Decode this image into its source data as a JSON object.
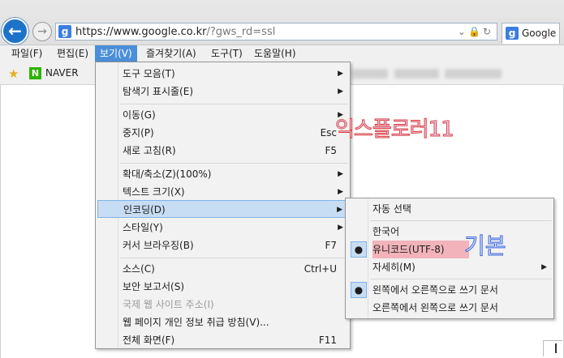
{
  "address_bar": {
    "url_main": "https://www.google.co.kr",
    "url_rest": "/?gws_rd=ssl"
  },
  "tab": {
    "title": "Google"
  },
  "menubar": [
    "파일(F)",
    "편집(E)",
    "보기(V)",
    "즐겨찾기(A)",
    "도구(T)",
    "도움말(H)"
  ],
  "favorites": {
    "naver_label": "NAVER"
  },
  "view_menu": {
    "items": [
      {
        "label": "도구 모음(T)",
        "shortcut": "",
        "submenu": true
      },
      {
        "label": "탐색기 표시줄(E)",
        "shortcut": "",
        "submenu": true
      },
      {
        "label": "이동(G)",
        "shortcut": "",
        "submenu": true
      },
      {
        "label": "중지(P)",
        "shortcut": "Esc",
        "submenu": false
      },
      {
        "label": "새로 고침(R)",
        "shortcut": "F5",
        "submenu": false
      },
      {
        "label": "확대/축소(Z)(100%)",
        "shortcut": "",
        "submenu": true
      },
      {
        "label": "텍스트 크기(X)",
        "shortcut": "",
        "submenu": true
      },
      {
        "label": "인코딩(D)",
        "shortcut": "",
        "submenu": true
      },
      {
        "label": "스타일(Y)",
        "shortcut": "",
        "submenu": true
      },
      {
        "label": "커서 브라우징(B)",
        "shortcut": "F7",
        "submenu": false
      },
      {
        "label": "소스(C)",
        "shortcut": "Ctrl+U",
        "submenu": false
      },
      {
        "label": "보안 보고서(S)",
        "shortcut": "",
        "submenu": false
      },
      {
        "label": "국제 웹 사이트 주소(I)",
        "shortcut": "",
        "submenu": false
      },
      {
        "label": "웹 페이지 개인 정보 취급 방침(V)...",
        "shortcut": "",
        "submenu": false
      },
      {
        "label": "전체 화면(F)",
        "shortcut": "F11",
        "submenu": false
      }
    ]
  },
  "encoding_menu": {
    "items": [
      {
        "label": "자동 선택"
      },
      {
        "label": "한국어"
      },
      {
        "label": "유니코드(UTF-8)"
      },
      {
        "label": "자세히(M)"
      },
      {
        "label": "왼쪽에서 오른쪽으로 쓰기 문서"
      },
      {
        "label": "오른쪽에서 왼쪽으로 쓰기 문서"
      }
    ]
  },
  "annotations": {
    "explorer": "익스플로러11",
    "default": "기본"
  },
  "colors": {
    "highlight": "#c7ddf3",
    "menu_active": "#4a8fd8",
    "annotation_red": "#e23b3b",
    "annotation_blue": "#3a66d6"
  }
}
